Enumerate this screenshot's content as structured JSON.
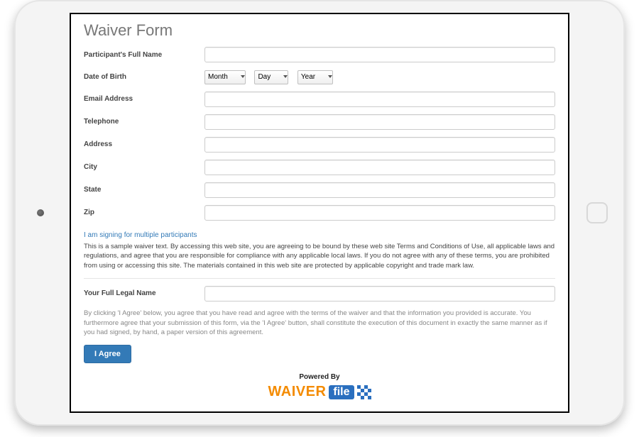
{
  "title": "Waiver Form",
  "fields": {
    "full_name": {
      "label": "Participant's Full Name",
      "value": ""
    },
    "dob": {
      "label": "Date of Birth",
      "month": "Month",
      "day": "Day",
      "year": "Year"
    },
    "email": {
      "label": "Email Address",
      "value": ""
    },
    "telephone": {
      "label": "Telephone",
      "value": ""
    },
    "address": {
      "label": "Address",
      "value": ""
    },
    "city": {
      "label": "City",
      "value": ""
    },
    "state": {
      "label": "State",
      "value": ""
    },
    "zip": {
      "label": "Zip",
      "value": ""
    },
    "legal_name": {
      "label": "Your Full Legal Name",
      "value": ""
    }
  },
  "multi_link": "I am signing for multiple participants",
  "waiver_text": "This is a sample waiver text. By accessing this web site, you are agreeing to be bound by these web site Terms and Conditions of Use, all applicable laws and regulations, and agree that you are responsible for compliance with any applicable local laws. If you do not agree with any of these terms, you are prohibited from using or accessing this site. The materials contained in this web site are protected by applicable copyright and trade mark law.",
  "agree_text": "By clicking 'I Agree' below, you agree that you have read and agree with the terms of the waiver and that the information you provided is accurate. You furthermore agree that your submission of this form, via the 'I Agree' button, shall constitute the execution of this document in exactly the same manner as if you had signed, by hand, a paper version of this agreement.",
  "agree_button": "I Agree",
  "powered_by": "Powered By",
  "logo": {
    "part1": "WAIVER",
    "part2": "file"
  }
}
